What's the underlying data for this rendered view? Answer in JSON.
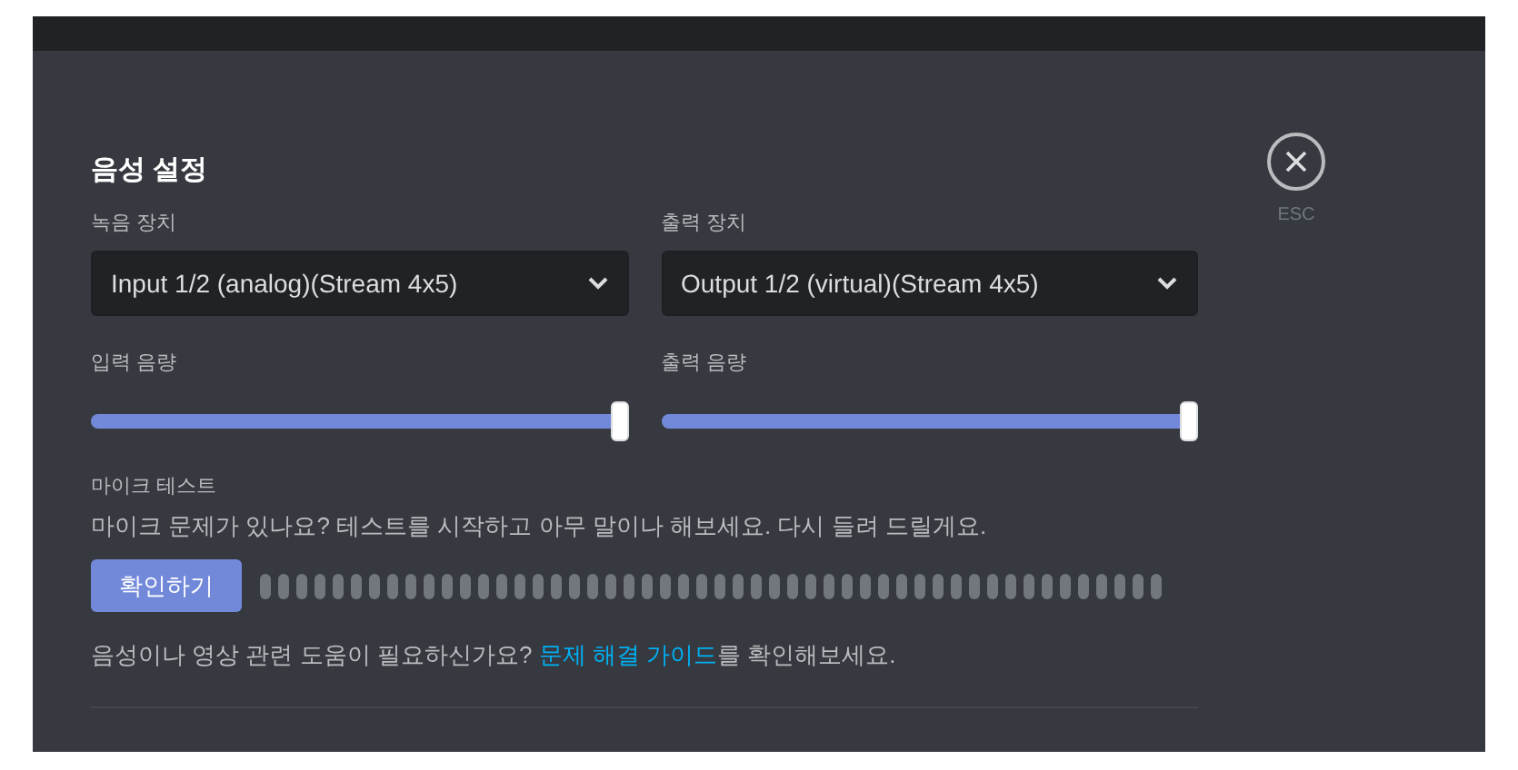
{
  "title": "음성 설정",
  "close": {
    "icon_label": "ESC"
  },
  "devices": [
    {
      "label": "녹음 장치",
      "value": "Input 1/2 (analog)(Stream 4x5)"
    },
    {
      "label": "출력 장치",
      "value": "Output 1/2 (virtual)(Stream 4x5)"
    }
  ],
  "volumes": [
    {
      "label": "입력 음량",
      "level": 1
    },
    {
      "label": "출력 음량",
      "level": 1
    }
  ],
  "mic_test": {
    "label": "마이크 테스트",
    "description": "마이크 문제가 있나요? 테스트를 시작하고 아무 말이나 해보세요. 다시 들려 드릴게요.",
    "button": "확인하기"
  },
  "help": {
    "before": "음성이나 영상 관련 도움이 필요하신가요? ",
    "link": "문제 해결 가이드",
    "after": "를 확인해보세요."
  }
}
